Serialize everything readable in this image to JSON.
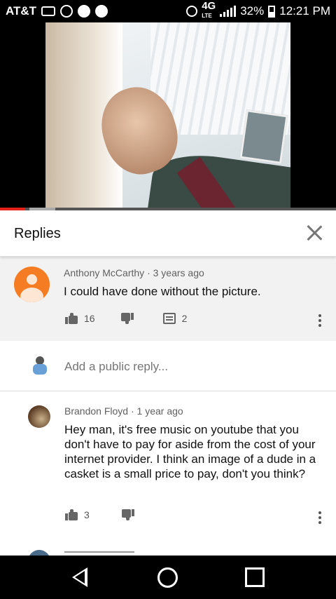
{
  "status_bar": {
    "carrier": "AT&T",
    "network": "4G",
    "network_sub": "LTE",
    "battery": "32%",
    "time": "12:21 PM",
    "icons": [
      "voicemail-icon",
      "at-icon",
      "do-not-disturb-icon",
      "notification-icon",
      "bluetooth-icon",
      "signal-icon",
      "battery-icon"
    ]
  },
  "video": {
    "progress_played": 0.075,
    "progress_buffered_end": 0.165,
    "accent_color": "#e62117"
  },
  "replies_panel": {
    "title": "Replies"
  },
  "main_comment": {
    "author": "Anthony McCarthy",
    "separator": "·",
    "time": "3 years ago",
    "text": "I could have done without the picture.",
    "likes": "16",
    "replies": "2",
    "avatar_color": "#f57c22"
  },
  "add_reply": {
    "placeholder": "Add a public reply..."
  },
  "replies": [
    {
      "author": "Brandon Floyd",
      "separator": "·",
      "time": "1 year ago",
      "text": "Hey man, it's free music on youtube that you don't have to pay for aside from the cost of your internet provider. I think an image of a dude in a casket is a small price to pay, don't you think?",
      "likes": "3"
    }
  ]
}
